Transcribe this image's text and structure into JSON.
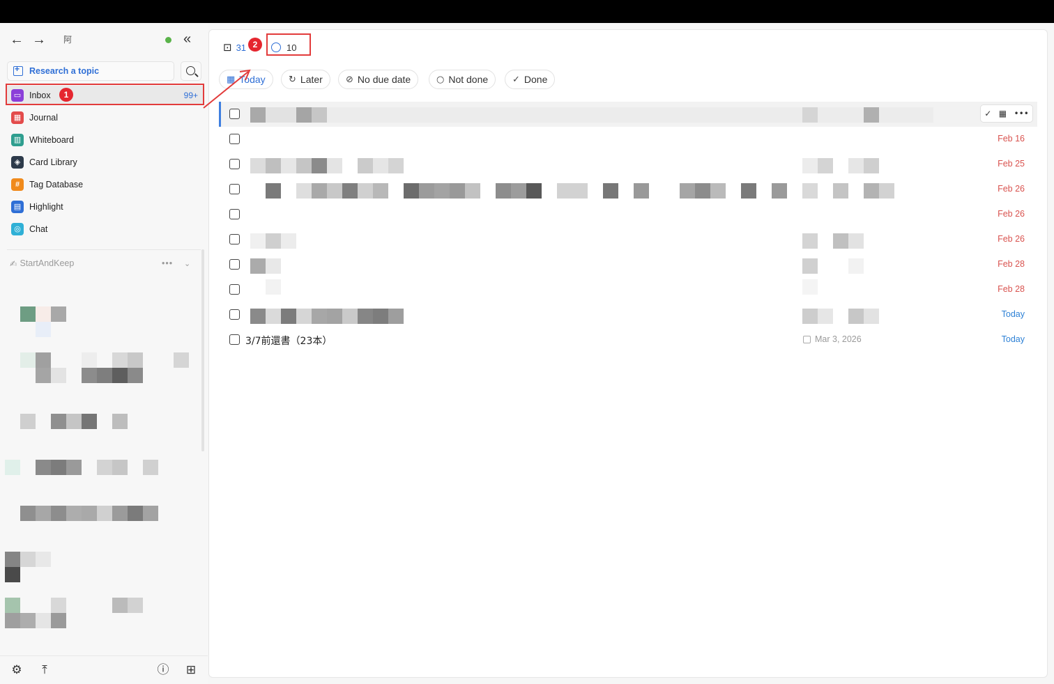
{
  "sidebar": {
    "workspace_glyph": "阿",
    "research_label": "Research a topic",
    "menu": [
      {
        "label": "Inbox",
        "icon": "inbox-icon",
        "color": "#8b3fd9",
        "count": "99+"
      },
      {
        "label": "Journal",
        "icon": "calendar-icon",
        "color": "#e34b4b"
      },
      {
        "label": "Whiteboard",
        "icon": "whiteboard-icon",
        "color": "#2f9e8f"
      },
      {
        "label": "Card Library",
        "icon": "layers-icon",
        "color": "#2d3a4a"
      },
      {
        "label": "Tag Database",
        "icon": "hash-icon",
        "color": "#f08a1c"
      },
      {
        "label": "Highlight",
        "icon": "highlight-icon",
        "color": "#2f6fd6"
      },
      {
        "label": "Chat",
        "icon": "chat-icon",
        "color": "#2fb0d6"
      }
    ],
    "space_name": "StartAndKeep"
  },
  "annotations": {
    "badge1": "1",
    "badge2": "2"
  },
  "main": {
    "tabs": [
      {
        "icon": "inbox-tray-icon",
        "count": "31"
      },
      {
        "icon": "check-circle-icon",
        "count": "10"
      }
    ],
    "filters": [
      {
        "label": "Today",
        "icon": "calendar-icon",
        "active": true
      },
      {
        "label": "Later",
        "icon": "refresh-icon",
        "active": false
      },
      {
        "label": "No due date",
        "icon": "no-date-icon",
        "active": false
      },
      {
        "label": "Not done",
        "icon": "circle-icon",
        "active": false
      },
      {
        "label": "Done",
        "icon": "check-icon",
        "active": false
      }
    ],
    "tasks": [
      {
        "date": ""
      },
      {
        "date": "Feb 16",
        "color": "red"
      },
      {
        "date": "Feb 25",
        "color": "red"
      },
      {
        "date": "Feb 26",
        "color": "red"
      },
      {
        "date": "Feb 26",
        "color": "red"
      },
      {
        "date": "Feb 26",
        "color": "red"
      },
      {
        "date": "Feb 28",
        "color": "red"
      },
      {
        "date": "Feb 28",
        "color": "red"
      },
      {
        "date": "Today",
        "color": "blue"
      },
      {
        "title": "3/7前還書（23本）",
        "due": "Mar 3, 2026",
        "date": "Today",
        "color": "blue"
      }
    ]
  }
}
